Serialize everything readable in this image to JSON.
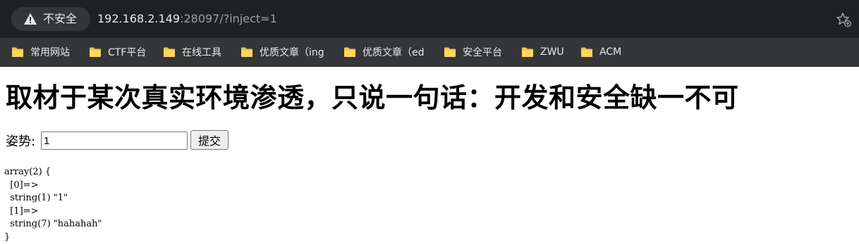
{
  "browser": {
    "security_label": "不安全",
    "url_host": "192.168.2.149",
    "url_rest": ":28097/?inject=1",
    "bookmarks": [
      {
        "label": "常用网站"
      },
      {
        "label": "CTF平台"
      },
      {
        "label": "在线工具"
      },
      {
        "label": "优质文章（ing"
      },
      {
        "label": "优质文章（ed"
      },
      {
        "label": "安全平台"
      },
      {
        "label": "ZWU"
      },
      {
        "label": "ACM"
      }
    ]
  },
  "page": {
    "heading": "取材于某次真实环境渗透，只说一句话：开发和安全缺一不可",
    "form_label": "姿势:",
    "input_value": "1",
    "submit_label": "提交",
    "dump_lines": [
      "array(2) {",
      "  [0]=>",
      "  string(1) \"1\"",
      "  [1]=>",
      "  string(7) \"hahahah\"",
      "}"
    ]
  }
}
